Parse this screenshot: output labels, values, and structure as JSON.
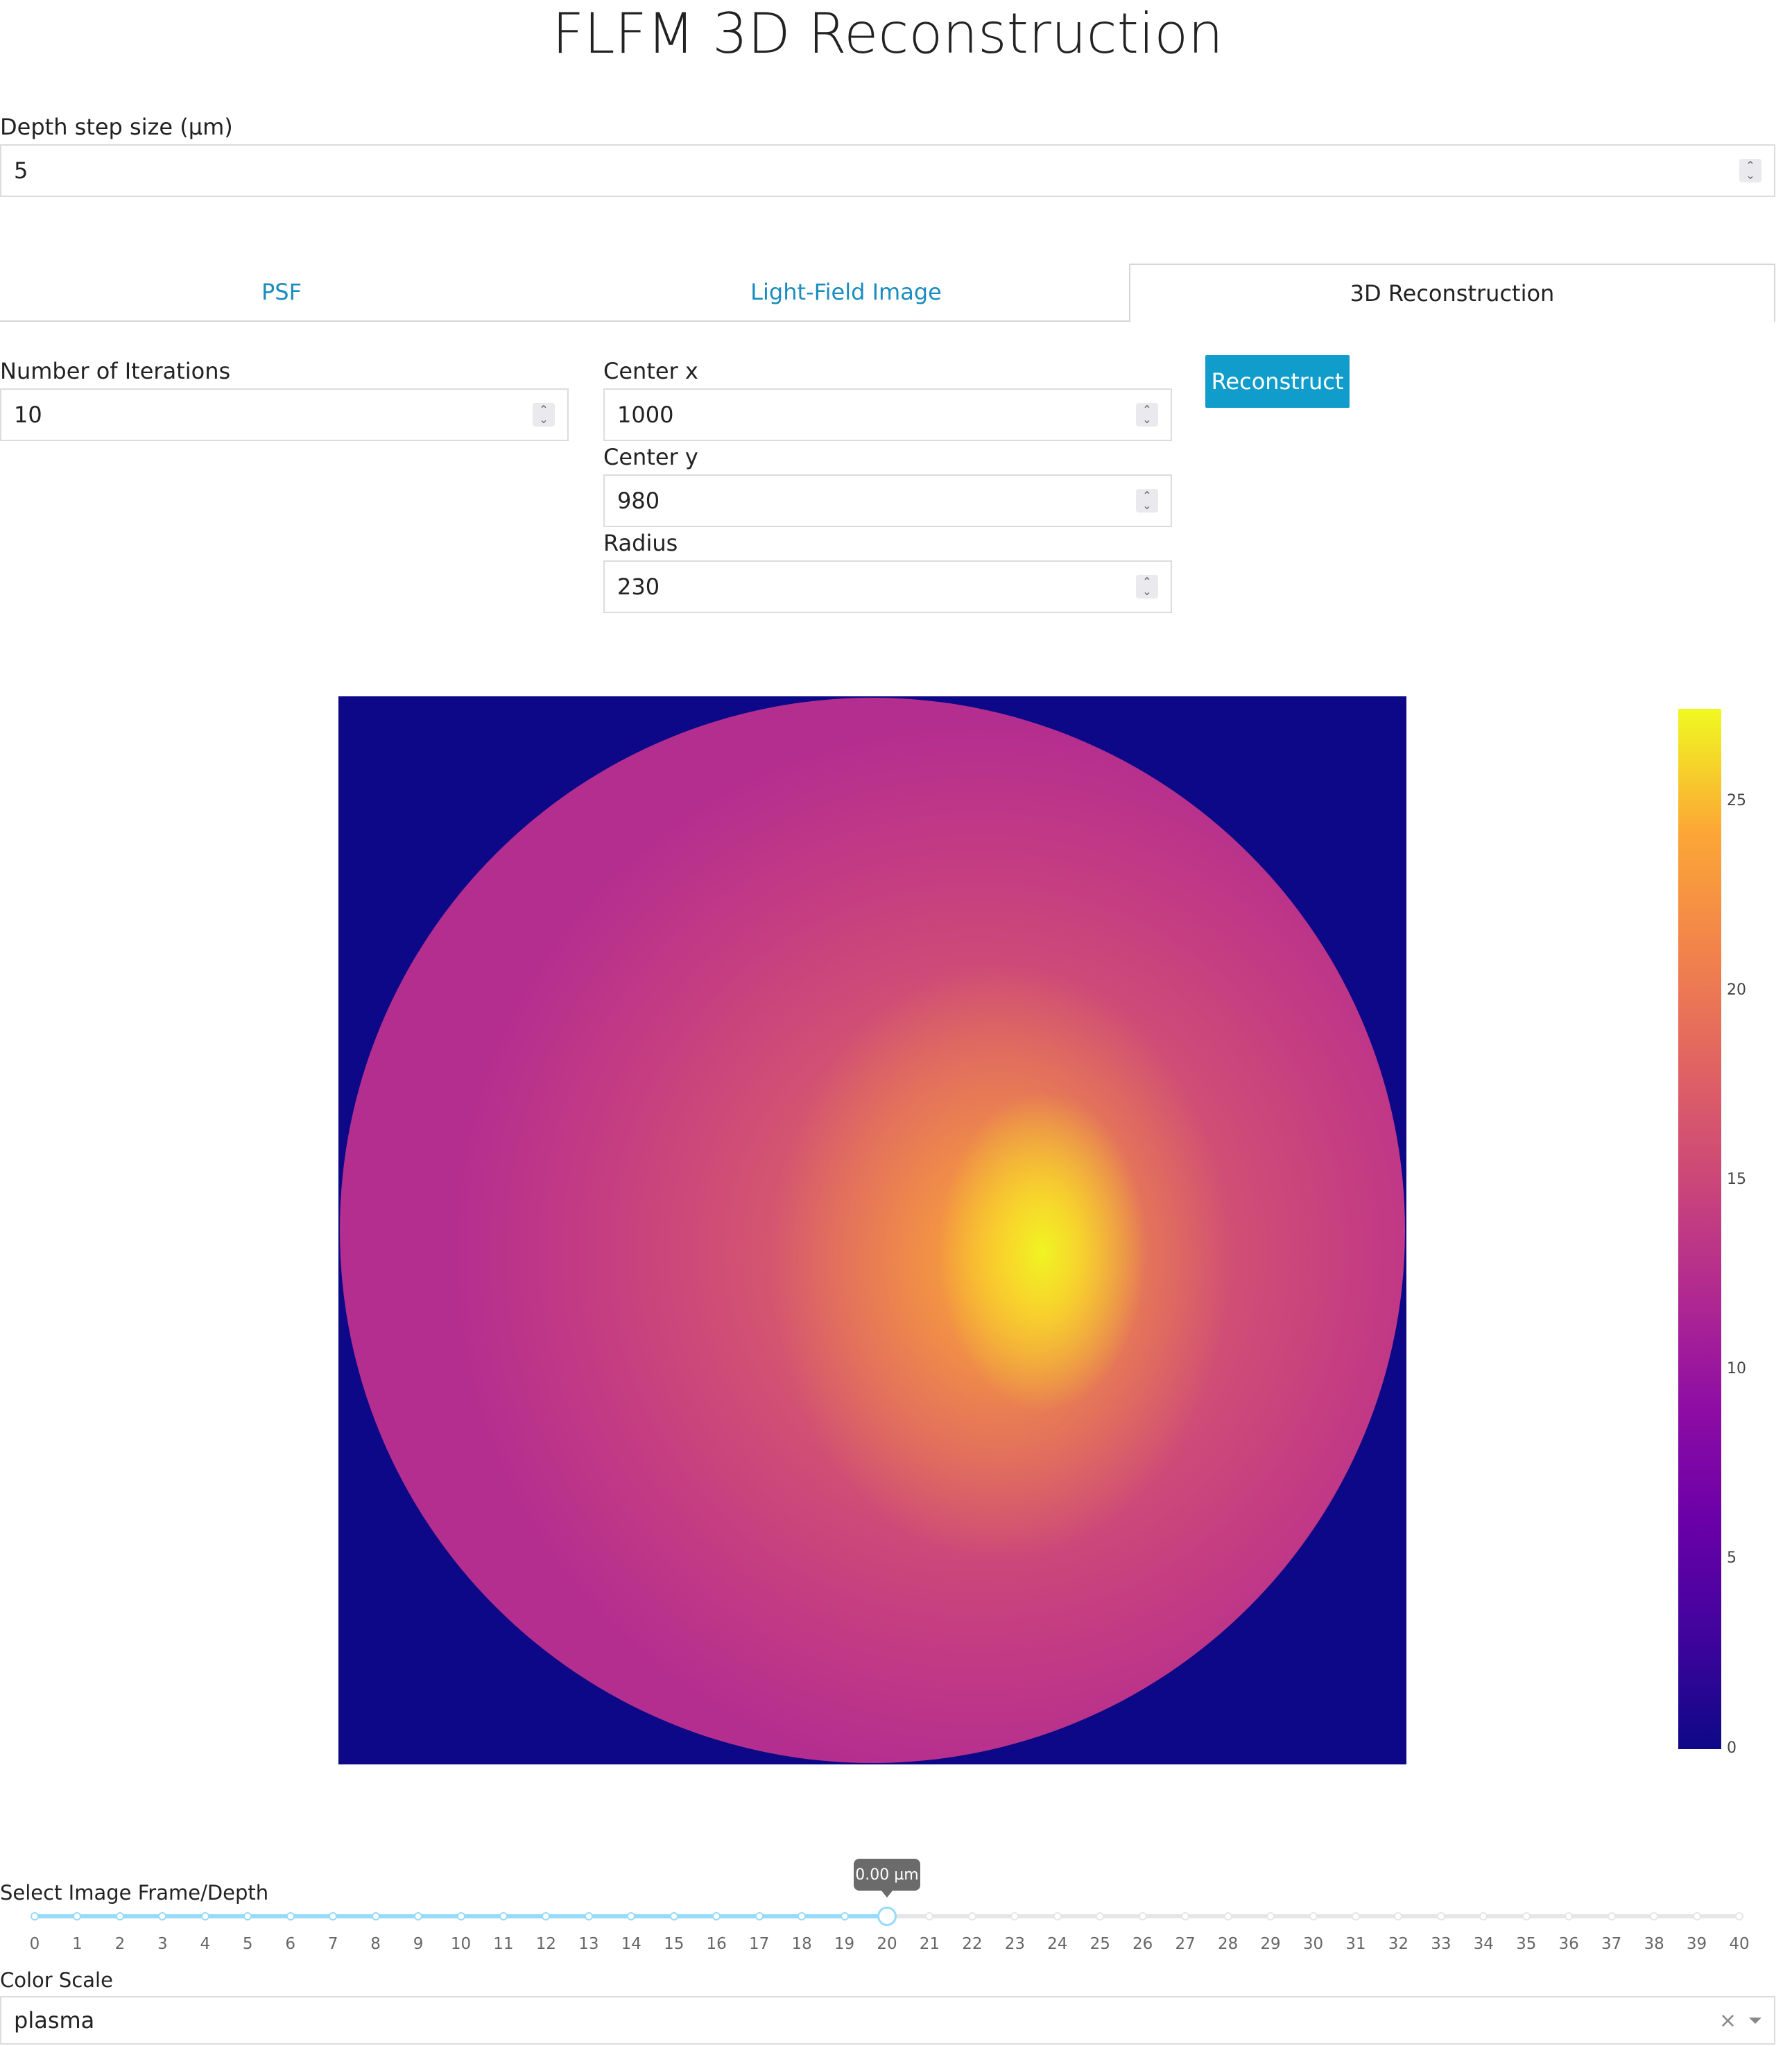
{
  "header": {
    "title": "FLFM 3D Reconstruction"
  },
  "depth_step": {
    "label": "Depth step size (µm)",
    "value": "5"
  },
  "tabs": [
    {
      "label": "PSF",
      "active": false
    },
    {
      "label": "Light-Field Image",
      "active": false
    },
    {
      "label": "3D Reconstruction",
      "active": true
    }
  ],
  "form": {
    "iterations": {
      "label": "Number of Iterations",
      "value": "10"
    },
    "center_x": {
      "label": "Center x",
      "value": "1000"
    },
    "center_y": {
      "label": "Center y",
      "value": "980"
    },
    "radius": {
      "label": "Radius",
      "value": "230"
    },
    "reconstruct_label": "Reconstruct"
  },
  "heatmap": {
    "colorscale": "plasma",
    "colorbar_ticks": [
      "25",
      "20",
      "15",
      "10",
      "5",
      "0"
    ],
    "range": [
      0,
      27.5
    ]
  },
  "slider": {
    "label": "Select Image Frame/Depth",
    "value": 20,
    "tooltip": "0.00 µm",
    "marks": [
      "0",
      "1",
      "2",
      "3",
      "4",
      "5",
      "6",
      "7",
      "8",
      "9",
      "10",
      "11",
      "12",
      "13",
      "14",
      "15",
      "16",
      "17",
      "18",
      "19",
      "20",
      "21",
      "22",
      "23",
      "24",
      "25",
      "26",
      "27",
      "28",
      "29",
      "30",
      "31",
      "32",
      "33",
      "34",
      "35",
      "36",
      "37",
      "38",
      "39",
      "40"
    ]
  },
  "color_scale": {
    "label": "Color Scale",
    "value": "plasma",
    "clear_icon": "×"
  },
  "colors": {
    "accent": "#119dcb",
    "tab_link": "#1a8cbf",
    "slider_active": "#96dbfa",
    "slider_inactive": "#e6e6e6"
  }
}
